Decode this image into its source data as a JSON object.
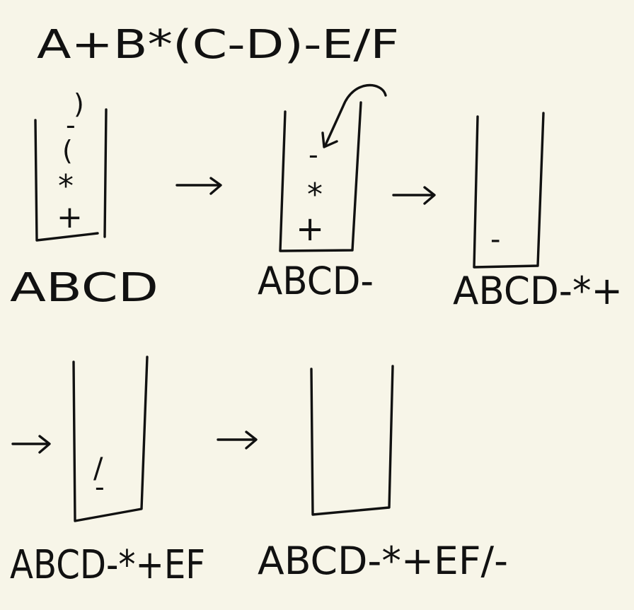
{
  "expression": "A+B*(C-D)-E/F",
  "steps": [
    {
      "stack_items": [
        ")",
        "-",
        "(",
        "*",
        "+"
      ],
      "output": "ABCD"
    },
    {
      "stack_items": [
        "-",
        "*",
        "+"
      ],
      "output": "ABCD-"
    },
    {
      "stack_items": [
        "-"
      ],
      "output": "ABCD-*+"
    },
    {
      "stack_items": [
        "/",
        "-"
      ],
      "output": "ABCD-*+EF"
    },
    {
      "stack_items": [],
      "output": "ABCD-*+EF/-"
    }
  ],
  "arrow_symbol": "→"
}
